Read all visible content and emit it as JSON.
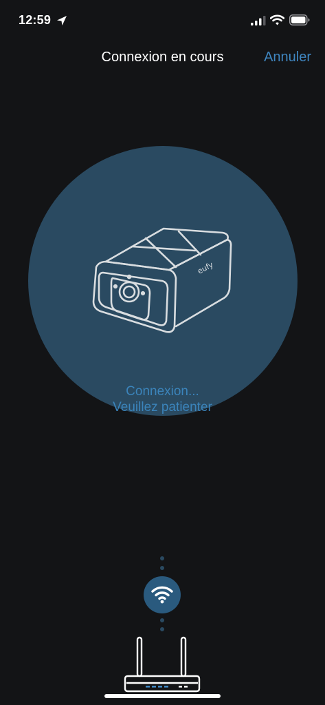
{
  "status_bar": {
    "time": "12:59"
  },
  "nav": {
    "title": "Connexion en cours",
    "cancel_label": "Annuler"
  },
  "connection": {
    "status_line1": "Connexion...",
    "status_line2": "Veuillez patienter"
  },
  "colors": {
    "background": "#131416",
    "circle": "#2a4a61",
    "accent": "#3f86c0",
    "badge": "#2a5a7e"
  },
  "icons": [
    "location-arrow-icon",
    "cellular-signal-icon",
    "wifi-status-icon",
    "battery-icon",
    "camera-icon",
    "wifi-icon",
    "router-icon"
  ]
}
